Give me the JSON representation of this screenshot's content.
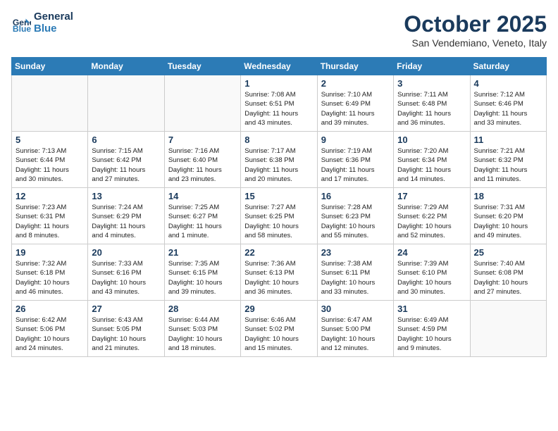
{
  "header": {
    "logo_line1": "General",
    "logo_line2": "Blue",
    "month": "October 2025",
    "location": "San Vendemiano, Veneto, Italy"
  },
  "weekdays": [
    "Sunday",
    "Monday",
    "Tuesday",
    "Wednesday",
    "Thursday",
    "Friday",
    "Saturday"
  ],
  "weeks": [
    [
      {
        "day": "",
        "info": ""
      },
      {
        "day": "",
        "info": ""
      },
      {
        "day": "",
        "info": ""
      },
      {
        "day": "1",
        "info": "Sunrise: 7:08 AM\nSunset: 6:51 PM\nDaylight: 11 hours\nand 43 minutes."
      },
      {
        "day": "2",
        "info": "Sunrise: 7:10 AM\nSunset: 6:49 PM\nDaylight: 11 hours\nand 39 minutes."
      },
      {
        "day": "3",
        "info": "Sunrise: 7:11 AM\nSunset: 6:48 PM\nDaylight: 11 hours\nand 36 minutes."
      },
      {
        "day": "4",
        "info": "Sunrise: 7:12 AM\nSunset: 6:46 PM\nDaylight: 11 hours\nand 33 minutes."
      }
    ],
    [
      {
        "day": "5",
        "info": "Sunrise: 7:13 AM\nSunset: 6:44 PM\nDaylight: 11 hours\nand 30 minutes."
      },
      {
        "day": "6",
        "info": "Sunrise: 7:15 AM\nSunset: 6:42 PM\nDaylight: 11 hours\nand 27 minutes."
      },
      {
        "day": "7",
        "info": "Sunrise: 7:16 AM\nSunset: 6:40 PM\nDaylight: 11 hours\nand 23 minutes."
      },
      {
        "day": "8",
        "info": "Sunrise: 7:17 AM\nSunset: 6:38 PM\nDaylight: 11 hours\nand 20 minutes."
      },
      {
        "day": "9",
        "info": "Sunrise: 7:19 AM\nSunset: 6:36 PM\nDaylight: 11 hours\nand 17 minutes."
      },
      {
        "day": "10",
        "info": "Sunrise: 7:20 AM\nSunset: 6:34 PM\nDaylight: 11 hours\nand 14 minutes."
      },
      {
        "day": "11",
        "info": "Sunrise: 7:21 AM\nSunset: 6:32 PM\nDaylight: 11 hours\nand 11 minutes."
      }
    ],
    [
      {
        "day": "12",
        "info": "Sunrise: 7:23 AM\nSunset: 6:31 PM\nDaylight: 11 hours\nand 8 minutes."
      },
      {
        "day": "13",
        "info": "Sunrise: 7:24 AM\nSunset: 6:29 PM\nDaylight: 11 hours\nand 4 minutes."
      },
      {
        "day": "14",
        "info": "Sunrise: 7:25 AM\nSunset: 6:27 PM\nDaylight: 11 hours\nand 1 minute."
      },
      {
        "day": "15",
        "info": "Sunrise: 7:27 AM\nSunset: 6:25 PM\nDaylight: 10 hours\nand 58 minutes."
      },
      {
        "day": "16",
        "info": "Sunrise: 7:28 AM\nSunset: 6:23 PM\nDaylight: 10 hours\nand 55 minutes."
      },
      {
        "day": "17",
        "info": "Sunrise: 7:29 AM\nSunset: 6:22 PM\nDaylight: 10 hours\nand 52 minutes."
      },
      {
        "day": "18",
        "info": "Sunrise: 7:31 AM\nSunset: 6:20 PM\nDaylight: 10 hours\nand 49 minutes."
      }
    ],
    [
      {
        "day": "19",
        "info": "Sunrise: 7:32 AM\nSunset: 6:18 PM\nDaylight: 10 hours\nand 46 minutes."
      },
      {
        "day": "20",
        "info": "Sunrise: 7:33 AM\nSunset: 6:16 PM\nDaylight: 10 hours\nand 43 minutes."
      },
      {
        "day": "21",
        "info": "Sunrise: 7:35 AM\nSunset: 6:15 PM\nDaylight: 10 hours\nand 39 minutes."
      },
      {
        "day": "22",
        "info": "Sunrise: 7:36 AM\nSunset: 6:13 PM\nDaylight: 10 hours\nand 36 minutes."
      },
      {
        "day": "23",
        "info": "Sunrise: 7:38 AM\nSunset: 6:11 PM\nDaylight: 10 hours\nand 33 minutes."
      },
      {
        "day": "24",
        "info": "Sunrise: 7:39 AM\nSunset: 6:10 PM\nDaylight: 10 hours\nand 30 minutes."
      },
      {
        "day": "25",
        "info": "Sunrise: 7:40 AM\nSunset: 6:08 PM\nDaylight: 10 hours\nand 27 minutes."
      }
    ],
    [
      {
        "day": "26",
        "info": "Sunrise: 6:42 AM\nSunset: 5:06 PM\nDaylight: 10 hours\nand 24 minutes."
      },
      {
        "day": "27",
        "info": "Sunrise: 6:43 AM\nSunset: 5:05 PM\nDaylight: 10 hours\nand 21 minutes."
      },
      {
        "day": "28",
        "info": "Sunrise: 6:44 AM\nSunset: 5:03 PM\nDaylight: 10 hours\nand 18 minutes."
      },
      {
        "day": "29",
        "info": "Sunrise: 6:46 AM\nSunset: 5:02 PM\nDaylight: 10 hours\nand 15 minutes."
      },
      {
        "day": "30",
        "info": "Sunrise: 6:47 AM\nSunset: 5:00 PM\nDaylight: 10 hours\nand 12 minutes."
      },
      {
        "day": "31",
        "info": "Sunrise: 6:49 AM\nSunset: 4:59 PM\nDaylight: 10 hours\nand 9 minutes."
      },
      {
        "day": "",
        "info": ""
      }
    ]
  ]
}
